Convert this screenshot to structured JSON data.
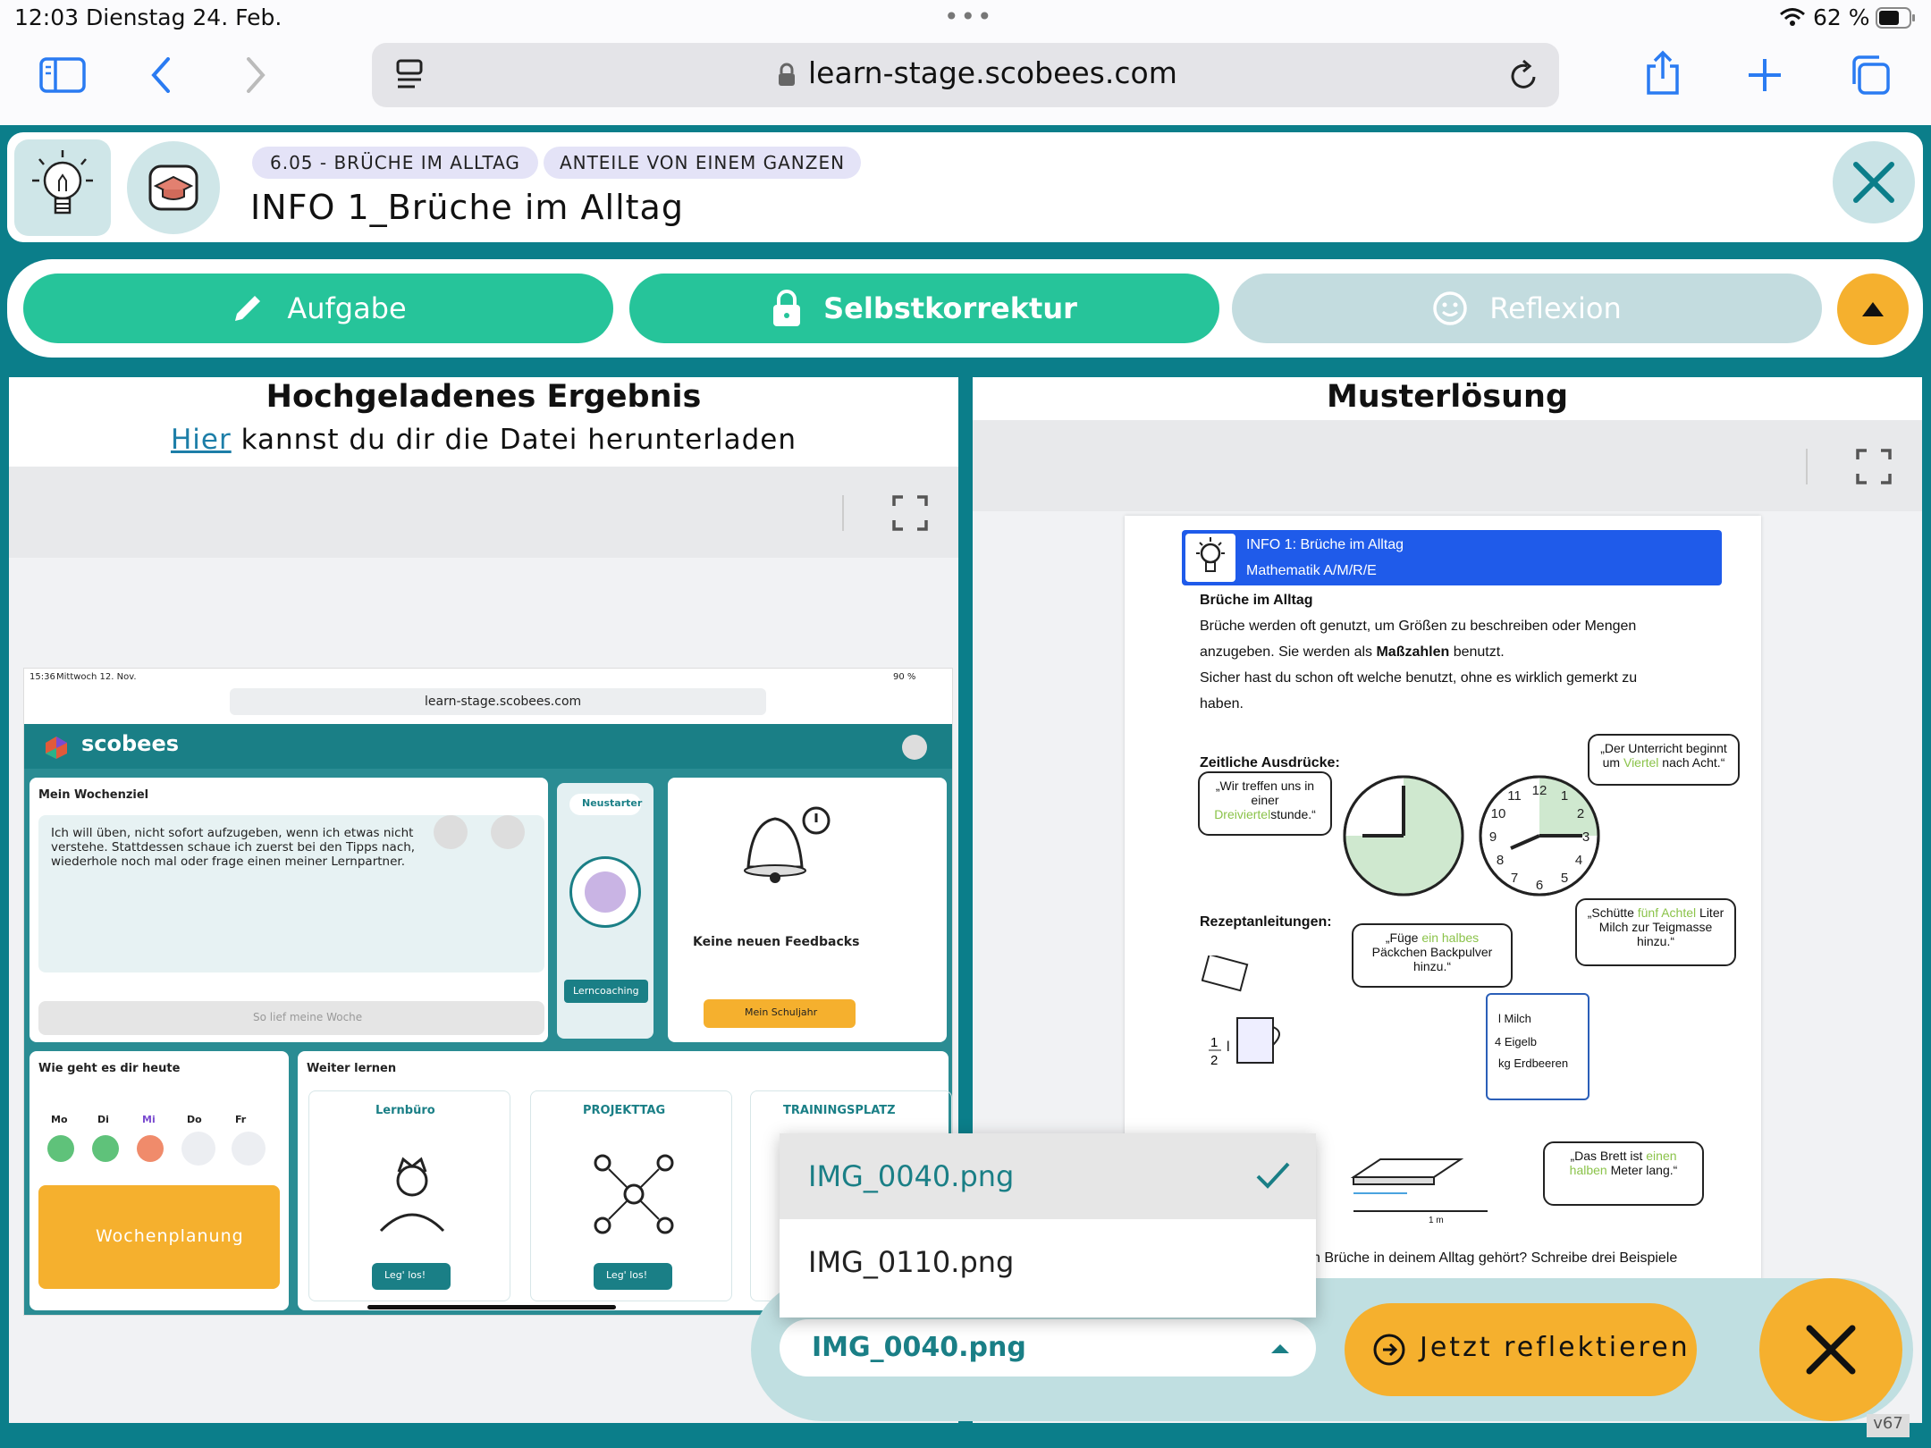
{
  "status": {
    "time": "12:03",
    "date": "Dienstag 24. Feb.",
    "battery": "62 %"
  },
  "browser": {
    "url": "learn-stage.scobees.com"
  },
  "header": {
    "tags": [
      "6.05 - BRÜCHE IM ALLTAG",
      "ANTEILE VON EINEM GANZEN"
    ],
    "title": "INFO 1_Brüche im Alltag"
  },
  "tabs": [
    {
      "label": "Aufgabe",
      "icon": "pencil-icon"
    },
    {
      "label": "Selbstkorrektur",
      "icon": "lock-icon"
    },
    {
      "label": "Reflexion",
      "icon": "smiley-icon"
    }
  ],
  "left": {
    "title": "Hochgeladenes Ergebnis",
    "link": "Hier",
    "subtitle": " kannst du dir die Datei herunterladen"
  },
  "right": {
    "title": "Musterlösung"
  },
  "shot": {
    "time": "15:36",
    "date": "Mittwoch 12. Nov.",
    "battery": "90 %",
    "url": "learn-stage.scobees.com",
    "brand": "scobees",
    "wochenziel_title": "Mein Wochenziel",
    "wochenziel_text": "Ich will üben, nicht sofort aufzugeben, wenn ich etwas nicht verstehe. Stattdessen schaue ich zuerst bei den Tipps nach, wiederhole noch mal oder frage einen meiner Lernpartner.",
    "woche_button": "So lief meine Woche",
    "neustarter": "Neustarter",
    "lerncoaching": "Lerncoaching",
    "feedback": "Keine neuen Feedbacks",
    "schuljahr": "Mein Schuljahr",
    "wie_geht": "Wie geht es dir heute",
    "days": [
      "Mo",
      "Di",
      "Mi",
      "Do",
      "Fr"
    ],
    "wochenplanung": "Wochenplanung",
    "weiter": "Weiter lernen",
    "cards": [
      "Lernbüro",
      "PROJEKTTAG",
      "TRAININGSPLATZ"
    ],
    "los": "Leg' los!"
  },
  "doc": {
    "banner1": "INFO 1: Brüche im Alltag",
    "banner2": "Mathematik A/M/R/E",
    "heading": "Brüche im Alltag",
    "p1": "Brüche werden oft genutzt, um Größen zu beschreiben oder Mengen",
    "p2a": "anzugeben. Sie werden als ",
    "p2b": "Maßzahlen",
    "p2c": " benutzt.",
    "p3": "Sicher hast du schon oft welche benutzt, ohne es wirklich gemerkt zu",
    "p4": "haben.",
    "zeit": "Zeitliche Ausdrücke:",
    "b1a": "„Wir treffen uns in einer ",
    "b1b": "Dreiviertel",
    "b1c": "stunde.“",
    "b2a": "„Der Unterricht beginnt um ",
    "b2b": "Viertel",
    "b2c": " nach Acht.“",
    "rezept": "Rezeptanleitungen:",
    "b3a": "„Füge ",
    "b3b": "ein halbes",
    "b3c": " Päckchen Backpulver hinzu.“",
    "b4a": "„Schütte ",
    "b4b": "fünf Achtel",
    "b4c": " Liter Milch zur Teigmasse hinzu.“",
    "scroll": [
      "l Milch",
      "4 Eigelb",
      "kg Erdbeeren"
    ],
    "b5a": "„Das Brett ist ",
    "b5b": "einen halben",
    "b5c": " Meter lang.“",
    "bottom": "n Brüche in deinem Alltag gehört? Schreibe drei Beispiele",
    "measure": "1 m",
    "half_l": "l"
  },
  "dropdown": {
    "options": [
      "IMG_0040.png",
      "IMG_0110.png"
    ],
    "selected": "IMG_0040.png"
  },
  "actions": {
    "reflect": "Jetzt reflektieren"
  },
  "version": "v67",
  "colors": {
    "teal": "#0b7e8a",
    "green": "#26c49a",
    "orange": "#f5b02e",
    "blue": "#1f5bea"
  }
}
